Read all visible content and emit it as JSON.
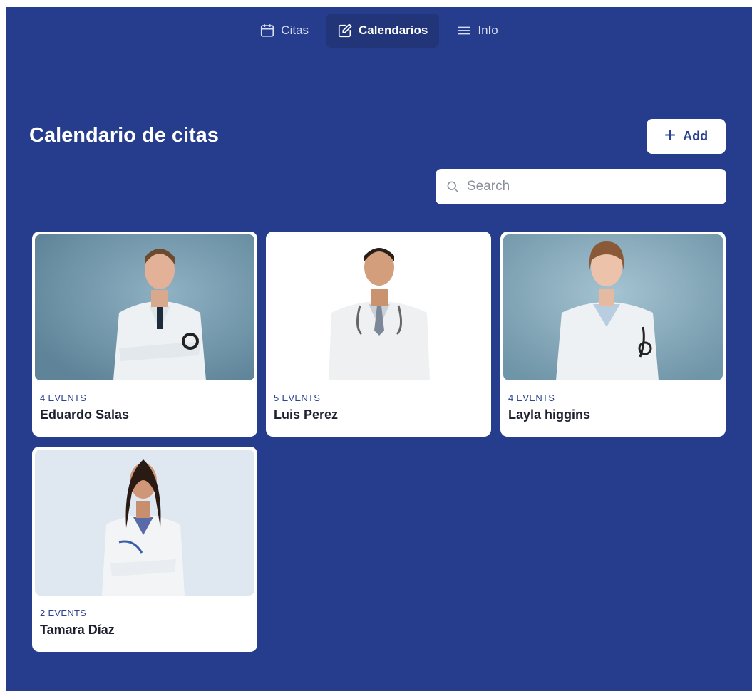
{
  "nav": {
    "items": [
      {
        "label": "Citas",
        "icon": "calendar-icon",
        "active": false
      },
      {
        "label": "Calendarios",
        "icon": "edit-icon",
        "active": true
      },
      {
        "label": "Info",
        "icon": "menu-icon",
        "active": false
      }
    ]
  },
  "page": {
    "title": "Calendario de citas",
    "add_label": "Add"
  },
  "search": {
    "placeholder": "Search",
    "value": ""
  },
  "colors": {
    "background": "#263c8c",
    "card": "#ffffff",
    "accent": "#27408f"
  },
  "cards": [
    {
      "events": "4 EVENTS",
      "name": "Eduardo Salas",
      "photo": "doctor-photo-blue-background"
    },
    {
      "events": "5 EVENTS",
      "name": "Luis Perez",
      "photo": "doctor-photo-white-background"
    },
    {
      "events": "4 EVENTS",
      "name": "Layla higgins",
      "photo": "doctor-photo-blue-background"
    },
    {
      "events": "2 EVENTS",
      "name": "Tamara Díaz",
      "photo": "doctor-photo-light-background"
    }
  ]
}
